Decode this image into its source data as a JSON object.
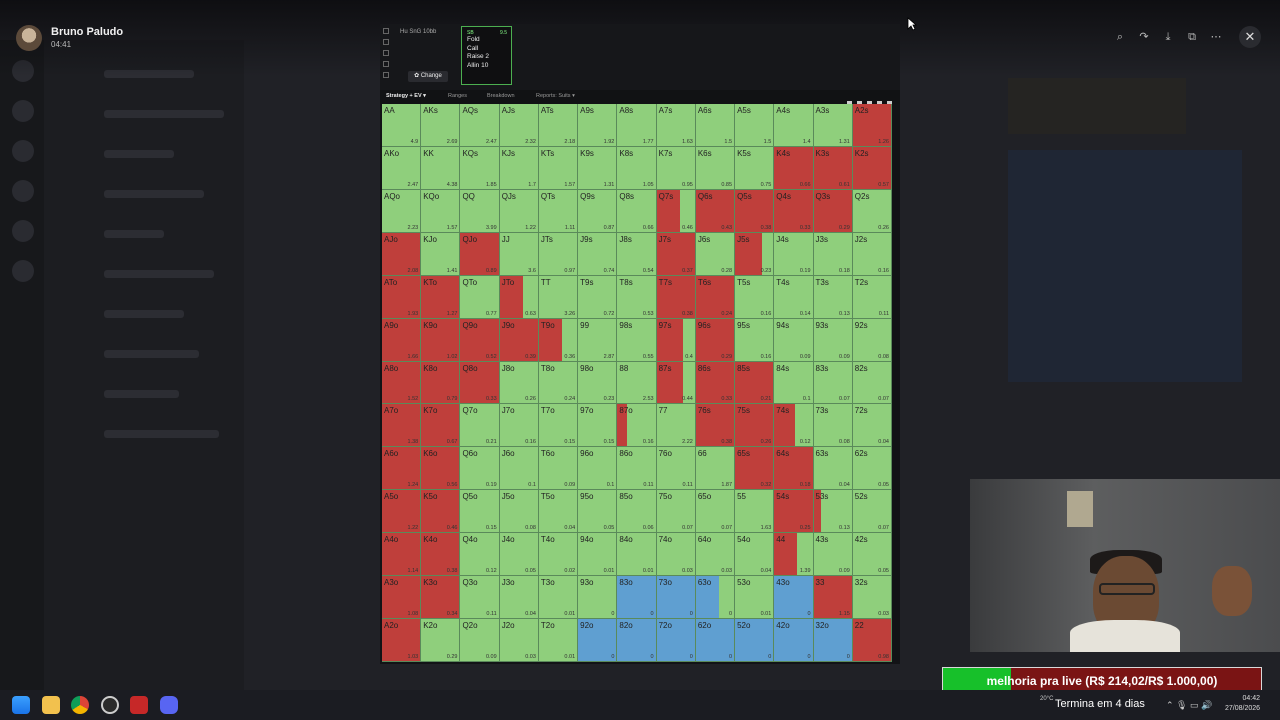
{
  "viewer": {
    "user_name": "Bruno Paludo",
    "time": "04:41",
    "tools": [
      "zoom-in-icon",
      "forward-icon",
      "download-icon",
      "open-external-icon",
      "more-icon"
    ]
  },
  "solver": {
    "game_label": "Hu SnG 10bb",
    "change_label": "✿ Change",
    "position": "SB",
    "stack": "9.5",
    "actions": [
      "Fold",
      "Call",
      "Raise 2",
      "Allin 10"
    ],
    "tabs": [
      "Strategy + EV ▾",
      "Ranges",
      "Breakdown",
      "Reports: Suits ▾"
    ],
    "colors": {
      "green": "#8fcf7c",
      "red": "#bf3f3b",
      "blue": "#5f9fd1"
    },
    "rows": [
      [
        [
          "AA",
          "4.9",
          "g",
          0
        ],
        [
          "AKs",
          "2.69",
          "g",
          0
        ],
        [
          "AQs",
          "2.47",
          "g",
          0
        ],
        [
          "AJs",
          "2.32",
          "g",
          0
        ],
        [
          "ATs",
          "2.18",
          "g",
          0
        ],
        [
          "A9s",
          "1.92",
          "g",
          0
        ],
        [
          "A8s",
          "1.77",
          "g",
          0
        ],
        [
          "A7s",
          "1.63",
          "g",
          0
        ],
        [
          "A6s",
          "1.5",
          "g",
          0
        ],
        [
          "A5s",
          "1.5",
          "g",
          0
        ],
        [
          "A4s",
          "1.4",
          "g",
          0
        ],
        [
          "A3s",
          "1.31",
          "g",
          0
        ],
        [
          "A2s",
          "1.26",
          "r",
          100
        ]
      ],
      [
        [
          "AKo",
          "2.47",
          "g",
          0
        ],
        [
          "KK",
          "4.38",
          "g",
          0
        ],
        [
          "KQs",
          "1.85",
          "g",
          0
        ],
        [
          "KJs",
          "1.7",
          "g",
          0
        ],
        [
          "KTs",
          "1.57",
          "g",
          0
        ],
        [
          "K9s",
          "1.31",
          "g",
          0
        ],
        [
          "K8s",
          "1.05",
          "g",
          0
        ],
        [
          "K7s",
          "0.95",
          "g",
          0
        ],
        [
          "K6s",
          "0.85",
          "g",
          0
        ],
        [
          "K5s",
          "0.75",
          "g",
          0
        ],
        [
          "K4s",
          "0.66",
          "r",
          100
        ],
        [
          "K3s",
          "0.61",
          "r",
          100
        ],
        [
          "K2s",
          "0.57",
          "r",
          100
        ]
      ],
      [
        [
          "AQo",
          "2.23",
          "g",
          12
        ],
        [
          "KQo",
          "1.57",
          "g",
          0
        ],
        [
          "QQ",
          "3.99",
          "g",
          0
        ],
        [
          "QJs",
          "1.22",
          "g",
          0
        ],
        [
          "QTs",
          "1.11",
          "g",
          0
        ],
        [
          "Q9s",
          "0.87",
          "g",
          0
        ],
        [
          "Q8s",
          "0.66",
          "g",
          0
        ],
        [
          "Q7s",
          "0.46",
          "r",
          60
        ],
        [
          "Q6s",
          "0.43",
          "r",
          100
        ],
        [
          "Q5s",
          "0.38",
          "r",
          100
        ],
        [
          "Q4s",
          "0.33",
          "r",
          100
        ],
        [
          "Q3s",
          "0.29",
          "r",
          100
        ],
        [
          "Q2s",
          "0.26",
          "g",
          0
        ]
      ],
      [
        [
          "AJo",
          "2.08",
          "r",
          100
        ],
        [
          "KJo",
          "1.41",
          "g",
          0
        ],
        [
          "QJo",
          "0.89",
          "r",
          100
        ],
        [
          "JJ",
          "3.6",
          "g",
          0
        ],
        [
          "JTs",
          "0.97",
          "g",
          0
        ],
        [
          "J9s",
          "0.74",
          "g",
          0
        ],
        [
          "J8s",
          "0.54",
          "g",
          0
        ],
        [
          "J7s",
          "0.37",
          "r",
          100
        ],
        [
          "J6s",
          "0.28",
          "g",
          0
        ],
        [
          "J5s",
          "0.23",
          "r",
          70
        ],
        [
          "J4s",
          "0.19",
          "g",
          0
        ],
        [
          "J3s",
          "0.18",
          "g",
          0
        ],
        [
          "J2s",
          "0.16",
          "g",
          0
        ]
      ],
      [
        [
          "ATo",
          "1.93",
          "r",
          100
        ],
        [
          "KTo",
          "1.27",
          "r",
          100
        ],
        [
          "QTo",
          "0.77",
          "g",
          0
        ],
        [
          "JTo",
          "0.63",
          "r",
          60
        ],
        [
          "TT",
          "3.26",
          "g",
          0
        ],
        [
          "T9s",
          "0.72",
          "g",
          0
        ],
        [
          "T8s",
          "0.53",
          "g",
          0
        ],
        [
          "T7s",
          "0.38",
          "r",
          100
        ],
        [
          "T6s",
          "0.24",
          "r",
          100
        ],
        [
          "T5s",
          "0.16",
          "g",
          0
        ],
        [
          "T4s",
          "0.14",
          "g",
          0
        ],
        [
          "T3s",
          "0.13",
          "g",
          0
        ],
        [
          "T2s",
          "0.11",
          "g",
          0
        ]
      ],
      [
        [
          "A9o",
          "1.66",
          "r",
          100
        ],
        [
          "K9o",
          "1.02",
          "r",
          100
        ],
        [
          "Q9o",
          "0.52",
          "r",
          100
        ],
        [
          "J9o",
          "0.39",
          "r",
          100
        ],
        [
          "T9o",
          "0.36",
          "r",
          60
        ],
        [
          "99",
          "2.87",
          "g",
          0
        ],
        [
          "98s",
          "0.55",
          "g",
          0
        ],
        [
          "97s",
          "0.4",
          "r",
          70
        ],
        [
          "96s",
          "0.29",
          "r",
          100
        ],
        [
          "95s",
          "0.16",
          "g",
          0
        ],
        [
          "94s",
          "0.09",
          "g",
          0
        ],
        [
          "93s",
          "0.09",
          "g",
          0
        ],
        [
          "92s",
          "0.08",
          "g",
          0
        ]
      ],
      [
        [
          "A8o",
          "1.52",
          "r",
          100
        ],
        [
          "K8o",
          "0.79",
          "r",
          100
        ],
        [
          "Q8o",
          "0.33",
          "r",
          100
        ],
        [
          "J8o",
          "0.26",
          "g",
          0
        ],
        [
          "T8o",
          "0.24",
          "g",
          0
        ],
        [
          "98o",
          "0.23",
          "g",
          0
        ],
        [
          "88",
          "2.53",
          "g",
          0
        ],
        [
          "87s",
          "0.44",
          "r",
          70
        ],
        [
          "86s",
          "0.33",
          "r",
          100
        ],
        [
          "85s",
          "0.21",
          "r",
          100
        ],
        [
          "84s",
          "0.1",
          "g",
          0
        ],
        [
          "83s",
          "0.07",
          "g",
          0
        ],
        [
          "82s",
          "0.07",
          "g",
          0
        ]
      ],
      [
        [
          "A7o",
          "1.38",
          "r",
          100
        ],
        [
          "K7o",
          "0.67",
          "r",
          100
        ],
        [
          "Q7o",
          "0.21",
          "g",
          0
        ],
        [
          "J7o",
          "0.16",
          "g",
          0
        ],
        [
          "T7o",
          "0.15",
          "g",
          0
        ],
        [
          "97o",
          "0.15",
          "g",
          0
        ],
        [
          "87o",
          "0.16",
          "r",
          25
        ],
        [
          "77",
          "2.22",
          "g",
          0
        ],
        [
          "76s",
          "0.38",
          "r",
          100
        ],
        [
          "75s",
          "0.26",
          "r",
          100
        ],
        [
          "74s",
          "0.12",
          "r",
          55
        ],
        [
          "73s",
          "0.08",
          "g",
          0
        ],
        [
          "72s",
          "0.04",
          "g",
          0
        ]
      ],
      [
        [
          "A6o",
          "1.24",
          "r",
          100
        ],
        [
          "K6o",
          "0.56",
          "r",
          100
        ],
        [
          "Q6o",
          "0.19",
          "g",
          0
        ],
        [
          "J6o",
          "0.1",
          "g",
          0
        ],
        [
          "T6o",
          "0.09",
          "g",
          0
        ],
        [
          "96o",
          "0.1",
          "g",
          0
        ],
        [
          "86o",
          "0.11",
          "g",
          0
        ],
        [
          "76o",
          "0.11",
          "g",
          0
        ],
        [
          "66",
          "1.87",
          "g",
          0
        ],
        [
          "65s",
          "0.32",
          "r",
          100
        ],
        [
          "64s",
          "0.18",
          "r",
          100
        ],
        [
          "63s",
          "0.04",
          "g",
          0
        ],
        [
          "62s",
          "0.05",
          "g",
          0
        ]
      ],
      [
        [
          "A5o",
          "1.22",
          "r",
          100
        ],
        [
          "K5o",
          "0.46",
          "r",
          100
        ],
        [
          "Q5o",
          "0.15",
          "g",
          0
        ],
        [
          "J5o",
          "0.08",
          "g",
          0
        ],
        [
          "T5o",
          "0.04",
          "g",
          0
        ],
        [
          "95o",
          "0.05",
          "g",
          0
        ],
        [
          "85o",
          "0.06",
          "g",
          0
        ],
        [
          "75o",
          "0.07",
          "g",
          0
        ],
        [
          "65o",
          "0.07",
          "g",
          0
        ],
        [
          "55",
          "1.63",
          "g",
          0
        ],
        [
          "54s",
          "0.25",
          "r",
          100
        ],
        [
          "53s",
          "0.13",
          "r",
          20
        ],
        [
          "52s",
          "0.07",
          "g",
          0
        ]
      ],
      [
        [
          "A4o",
          "1.14",
          "r",
          100
        ],
        [
          "K4o",
          "0.38",
          "r",
          100
        ],
        [
          "Q4o",
          "0.12",
          "g",
          0
        ],
        [
          "J4o",
          "0.05",
          "g",
          0
        ],
        [
          "T4o",
          "0.02",
          "g",
          0
        ],
        [
          "94o",
          "0.01",
          "g",
          0
        ],
        [
          "84o",
          "0.01",
          "g",
          0
        ],
        [
          "74o",
          "0.03",
          "g",
          0
        ],
        [
          "64o",
          "0.03",
          "g",
          0
        ],
        [
          "54o",
          "0.04",
          "g",
          0
        ],
        [
          "44",
          "1.39",
          "r",
          60
        ],
        [
          "43s",
          "0.09",
          "g",
          0
        ],
        [
          "42s",
          "0.05",
          "g",
          0
        ]
      ],
      [
        [
          "A3o",
          "1.08",
          "r",
          100
        ],
        [
          "K3o",
          "0.34",
          "r",
          100
        ],
        [
          "Q3o",
          "0.11",
          "g",
          0
        ],
        [
          "J3o",
          "0.04",
          "g",
          0
        ],
        [
          "T3o",
          "0.01",
          "g",
          0
        ],
        [
          "93o",
          "0",
          "g",
          0
        ],
        [
          "83o",
          "0",
          "b",
          100
        ],
        [
          "73o",
          "0",
          "b",
          100
        ],
        [
          "63o",
          "0",
          "b",
          60
        ],
        [
          "53o",
          "0.01",
          "g",
          0
        ],
        [
          "43o",
          "0",
          "b",
          100
        ],
        [
          "33",
          "1.15",
          "r",
          100
        ],
        [
          "32s",
          "0.03",
          "g",
          0
        ]
      ],
      [
        [
          "A2o",
          "1.03",
          "r",
          100
        ],
        [
          "K2o",
          "0.29",
          "g",
          0
        ],
        [
          "Q2o",
          "0.09",
          "g",
          0
        ],
        [
          "J2o",
          "0.03",
          "g",
          0
        ],
        [
          "T2o",
          "0.01",
          "g",
          0
        ],
        [
          "92o",
          "0",
          "b",
          100
        ],
        [
          "82o",
          "0",
          "b",
          100
        ],
        [
          "72o",
          "0",
          "b",
          100
        ],
        [
          "62o",
          "0",
          "b",
          100
        ],
        [
          "52o",
          "0",
          "b",
          100
        ],
        [
          "42o",
          "0",
          "b",
          100
        ],
        [
          "32o",
          "0",
          "b",
          100
        ],
        [
          "22",
          "0.98",
          "r",
          100
        ]
      ]
    ]
  },
  "stream": {
    "goal_text": "melhoria pra live (R$ 214,02/R$ 1.000,00)",
    "goal_progress": 0.214,
    "goal_colors": {
      "fill": "#17c02a",
      "remaining": "#7a1414"
    }
  },
  "taskbar": {
    "apps": [
      "windows-start-icon",
      "file-explorer-icon",
      "chrome-icon",
      "obs-icon",
      "poker-client-icon",
      "discord-icon"
    ],
    "weather_temp": "20°C",
    "promo_text": "Termina em 4 dias",
    "time": "04:42",
    "date": "27/08/2026"
  }
}
